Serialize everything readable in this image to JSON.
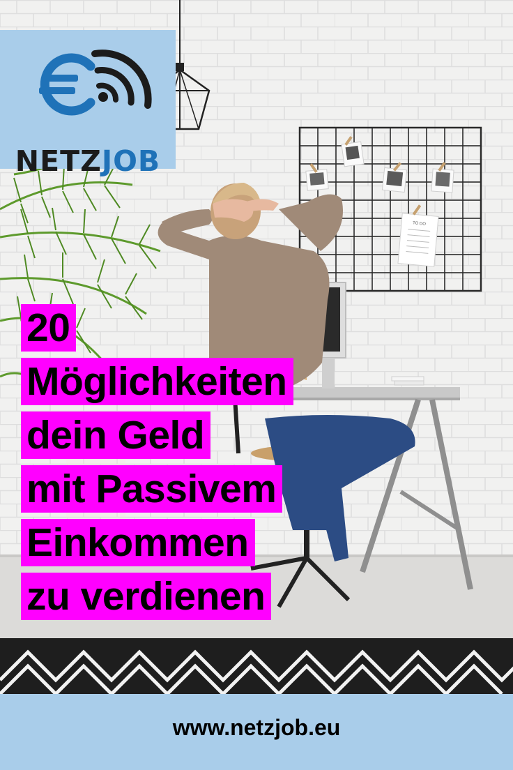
{
  "brand": {
    "name_part1": "NETZ",
    "name_part2": "JOB",
    "icon": "euro-wifi-logo-icon",
    "colors": {
      "box": "#a9cdea",
      "dark": "#1b1b1b",
      "blue": "#1f72b8"
    }
  },
  "headline": {
    "lines": [
      "20",
      "Möglichkeiten",
      "dein Geld",
      "mit Passivem",
      "Einkommen",
      "zu verdienen"
    ],
    "highlight_color": "#ff00ff"
  },
  "footer": {
    "url": "www.netzjob.eu",
    "background": "#a9cdea"
  },
  "photo": {
    "memo_text": "TO DO"
  }
}
